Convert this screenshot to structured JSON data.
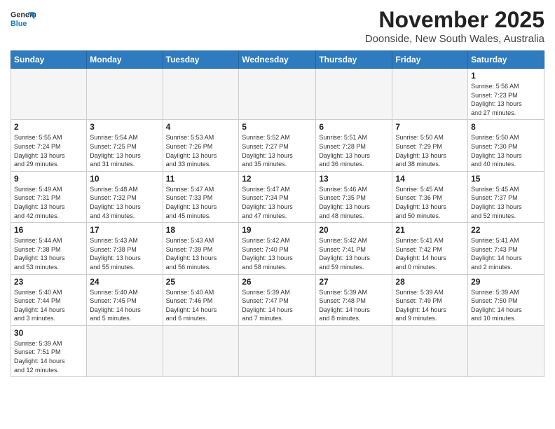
{
  "header": {
    "logo_general": "General",
    "logo_blue": "Blue",
    "month_title": "November 2025",
    "location": "Doonside, New South Wales, Australia"
  },
  "weekdays": [
    "Sunday",
    "Monday",
    "Tuesday",
    "Wednesday",
    "Thursday",
    "Friday",
    "Saturday"
  ],
  "weeks": [
    [
      {
        "day": "",
        "info": ""
      },
      {
        "day": "",
        "info": ""
      },
      {
        "day": "",
        "info": ""
      },
      {
        "day": "",
        "info": ""
      },
      {
        "day": "",
        "info": ""
      },
      {
        "day": "",
        "info": ""
      },
      {
        "day": "1",
        "info": "Sunrise: 5:56 AM\nSunset: 7:23 PM\nDaylight: 13 hours\nand 27 minutes."
      }
    ],
    [
      {
        "day": "2",
        "info": "Sunrise: 5:55 AM\nSunset: 7:24 PM\nDaylight: 13 hours\nand 29 minutes."
      },
      {
        "day": "3",
        "info": "Sunrise: 5:54 AM\nSunset: 7:25 PM\nDaylight: 13 hours\nand 31 minutes."
      },
      {
        "day": "4",
        "info": "Sunrise: 5:53 AM\nSunset: 7:26 PM\nDaylight: 13 hours\nand 33 minutes."
      },
      {
        "day": "5",
        "info": "Sunrise: 5:52 AM\nSunset: 7:27 PM\nDaylight: 13 hours\nand 35 minutes."
      },
      {
        "day": "6",
        "info": "Sunrise: 5:51 AM\nSunset: 7:28 PM\nDaylight: 13 hours\nand 36 minutes."
      },
      {
        "day": "7",
        "info": "Sunrise: 5:50 AM\nSunset: 7:29 PM\nDaylight: 13 hours\nand 38 minutes."
      },
      {
        "day": "8",
        "info": "Sunrise: 5:50 AM\nSunset: 7:30 PM\nDaylight: 13 hours\nand 40 minutes."
      }
    ],
    [
      {
        "day": "9",
        "info": "Sunrise: 5:49 AM\nSunset: 7:31 PM\nDaylight: 13 hours\nand 42 minutes."
      },
      {
        "day": "10",
        "info": "Sunrise: 5:48 AM\nSunset: 7:32 PM\nDaylight: 13 hours\nand 43 minutes."
      },
      {
        "day": "11",
        "info": "Sunrise: 5:47 AM\nSunset: 7:33 PM\nDaylight: 13 hours\nand 45 minutes."
      },
      {
        "day": "12",
        "info": "Sunrise: 5:47 AM\nSunset: 7:34 PM\nDaylight: 13 hours\nand 47 minutes."
      },
      {
        "day": "13",
        "info": "Sunrise: 5:46 AM\nSunset: 7:35 PM\nDaylight: 13 hours\nand 48 minutes."
      },
      {
        "day": "14",
        "info": "Sunrise: 5:45 AM\nSunset: 7:36 PM\nDaylight: 13 hours\nand 50 minutes."
      },
      {
        "day": "15",
        "info": "Sunrise: 5:45 AM\nSunset: 7:37 PM\nDaylight: 13 hours\nand 52 minutes."
      }
    ],
    [
      {
        "day": "16",
        "info": "Sunrise: 5:44 AM\nSunset: 7:38 PM\nDaylight: 13 hours\nand 53 minutes."
      },
      {
        "day": "17",
        "info": "Sunrise: 5:43 AM\nSunset: 7:38 PM\nDaylight: 13 hours\nand 55 minutes."
      },
      {
        "day": "18",
        "info": "Sunrise: 5:43 AM\nSunset: 7:39 PM\nDaylight: 13 hours\nand 56 minutes."
      },
      {
        "day": "19",
        "info": "Sunrise: 5:42 AM\nSunset: 7:40 PM\nDaylight: 13 hours\nand 58 minutes."
      },
      {
        "day": "20",
        "info": "Sunrise: 5:42 AM\nSunset: 7:41 PM\nDaylight: 13 hours\nand 59 minutes."
      },
      {
        "day": "21",
        "info": "Sunrise: 5:41 AM\nSunset: 7:42 PM\nDaylight: 14 hours\nand 0 minutes."
      },
      {
        "day": "22",
        "info": "Sunrise: 5:41 AM\nSunset: 7:43 PM\nDaylight: 14 hours\nand 2 minutes."
      }
    ],
    [
      {
        "day": "23",
        "info": "Sunrise: 5:40 AM\nSunset: 7:44 PM\nDaylight: 14 hours\nand 3 minutes."
      },
      {
        "day": "24",
        "info": "Sunrise: 5:40 AM\nSunset: 7:45 PM\nDaylight: 14 hours\nand 5 minutes."
      },
      {
        "day": "25",
        "info": "Sunrise: 5:40 AM\nSunset: 7:46 PM\nDaylight: 14 hours\nand 6 minutes."
      },
      {
        "day": "26",
        "info": "Sunrise: 5:39 AM\nSunset: 7:47 PM\nDaylight: 14 hours\nand 7 minutes."
      },
      {
        "day": "27",
        "info": "Sunrise: 5:39 AM\nSunset: 7:48 PM\nDaylight: 14 hours\nand 8 minutes."
      },
      {
        "day": "28",
        "info": "Sunrise: 5:39 AM\nSunset: 7:49 PM\nDaylight: 14 hours\nand 9 minutes."
      },
      {
        "day": "29",
        "info": "Sunrise: 5:39 AM\nSunset: 7:50 PM\nDaylight: 14 hours\nand 10 minutes."
      }
    ],
    [
      {
        "day": "30",
        "info": "Sunrise: 5:39 AM\nSunset: 7:51 PM\nDaylight: 14 hours\nand 12 minutes."
      },
      {
        "day": "",
        "info": ""
      },
      {
        "day": "",
        "info": ""
      },
      {
        "day": "",
        "info": ""
      },
      {
        "day": "",
        "info": ""
      },
      {
        "day": "",
        "info": ""
      },
      {
        "day": "",
        "info": ""
      }
    ]
  ]
}
